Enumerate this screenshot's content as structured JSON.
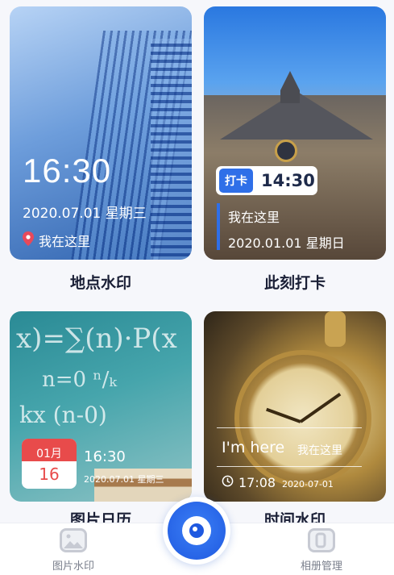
{
  "cards": [
    {
      "label": "地点水印",
      "time": "16:30",
      "date": "2020.07.01 星期三",
      "location": "我在这里"
    },
    {
      "label": "此刻打卡",
      "tag": "打卡",
      "time": "14:30",
      "location": "我在这里",
      "date": "2020.01.01 星期日"
    },
    {
      "label": "图片日历",
      "cal_month": "01月",
      "cal_day": "16",
      "time": "16:30",
      "date": "2020.07.01 星期三"
    },
    {
      "label": "时间水印",
      "imhere": "I'm here",
      "location": "我在这里",
      "time": "17:08",
      "date": "2020-07-01"
    }
  ],
  "bottom_nav": {
    "left_label": "图片水印",
    "right_label": "相册管理"
  },
  "colors": {
    "accent": "#1f59e0",
    "tag_blue": "#2f6fe8",
    "calendar_red": "#e84b4b",
    "label_text": "#1a1f36",
    "pin_red": "#e8495a"
  },
  "icons": [
    "location-pin-icon",
    "clock-icon",
    "image-icon",
    "album-icon",
    "camera-eye-icon"
  ]
}
